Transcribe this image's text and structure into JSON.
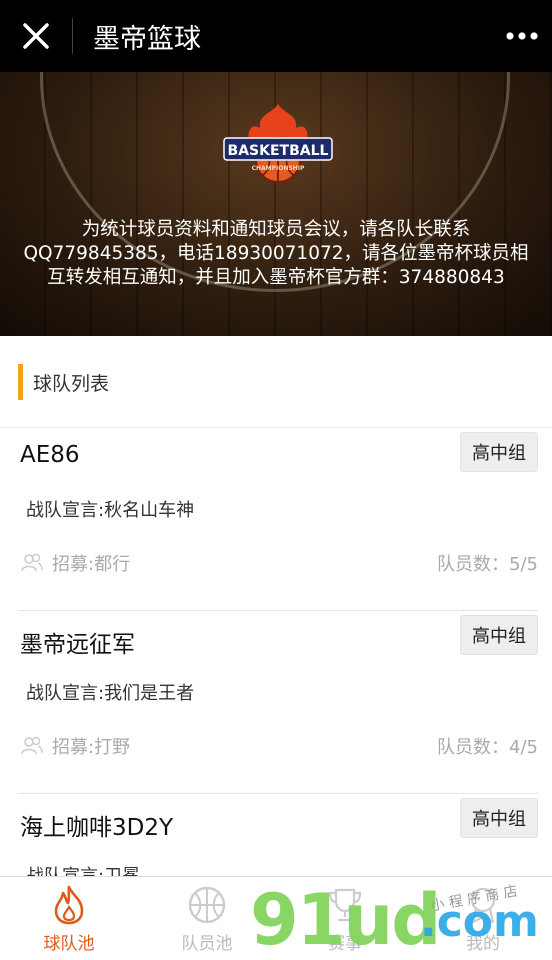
{
  "header": {
    "title": "墨帝篮球"
  },
  "banner": {
    "logo_text": "BASKETBALL",
    "logo_subtext": "CHAMPIONSHIP",
    "notice": "为统计球员资料和通知球员会议，请各队长联系QQ779845385，电话18930071072，请各位墨帝杯球员相互转发相互通知，并且加入墨帝杯官方群：374880843"
  },
  "section": {
    "title": "球队列表"
  },
  "teams": [
    {
      "name": "AE86",
      "group": "高中组",
      "slogan": "战队宣言:秋名山车神",
      "recruit": "招募:都行",
      "members": "队员数：5/5"
    },
    {
      "name": "墨帝远征军",
      "group": "高中组",
      "slogan": "战队宣言:我们是王者",
      "recruit": "招募:打野",
      "members": "队员数：4/5"
    },
    {
      "name": "海上咖啡3D2Y",
      "group": "高中组",
      "slogan": "战队宣言:卫冕",
      "recruit": "",
      "members": ""
    }
  ],
  "tabs": [
    {
      "label": "球队池",
      "icon": "flame-icon",
      "active": true
    },
    {
      "label": "队员池",
      "icon": "basketball-icon",
      "active": false
    },
    {
      "label": "赛事",
      "icon": "trophy-icon",
      "active": false
    },
    {
      "label": "我的",
      "icon": "medal-icon",
      "active": false
    }
  ],
  "watermark": {
    "text": "91ud",
    "suffix": ".com",
    "small": "小 程 序 商 店"
  },
  "colors": {
    "accent": "#e05a1c",
    "section_bar": "#f2a516",
    "watermark_green": "#7fd35a",
    "watermark_blue": "#27a7e6"
  }
}
